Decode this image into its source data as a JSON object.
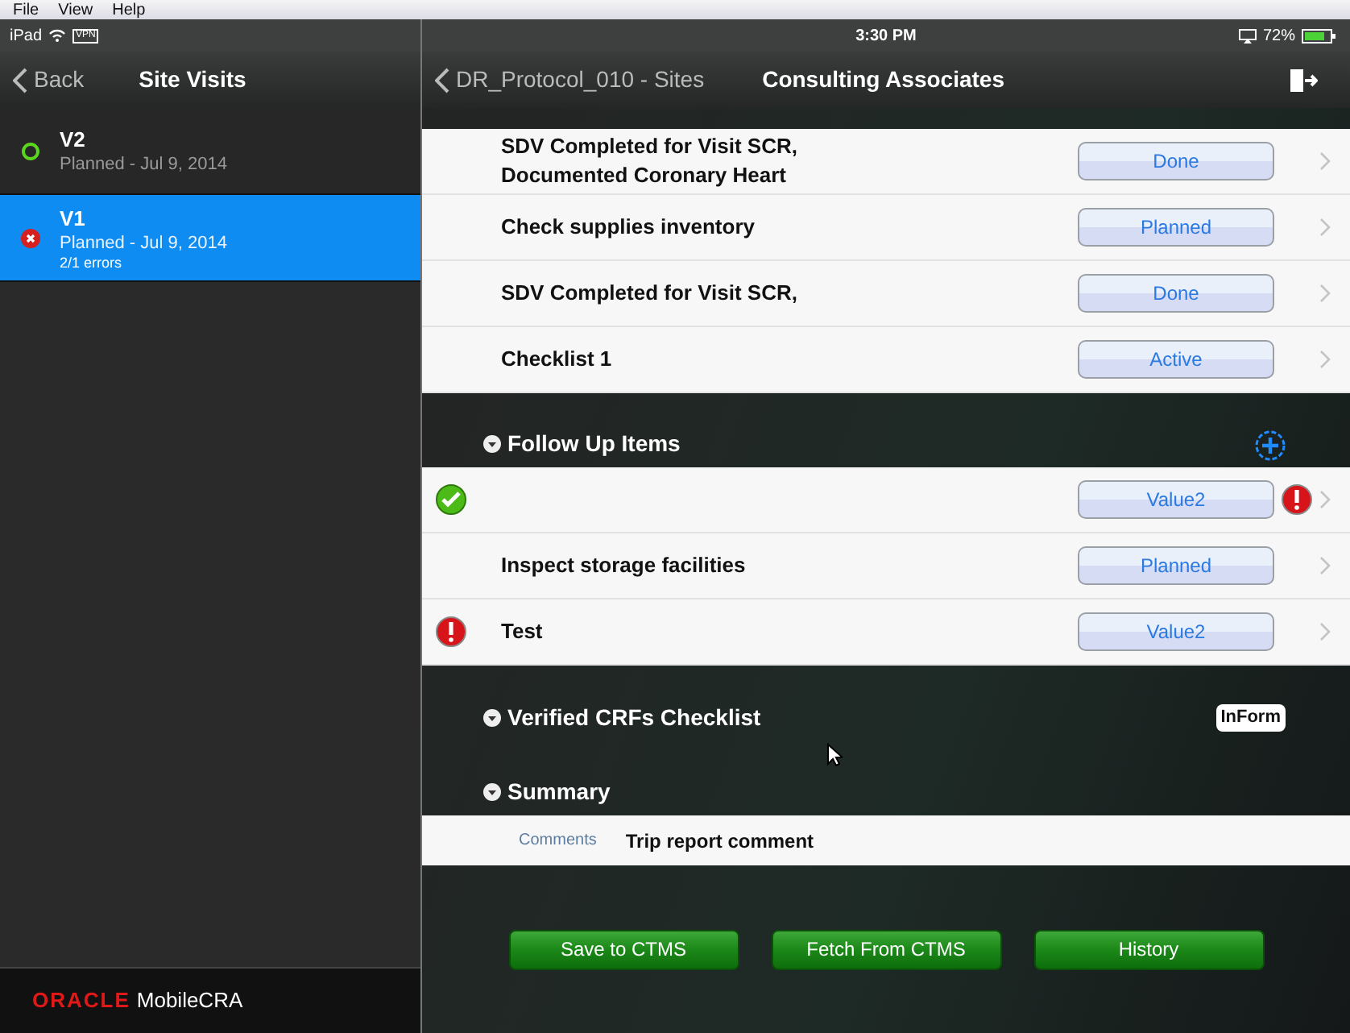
{
  "menu_bar": [
    "File",
    "View",
    "Help"
  ],
  "status_bar": {
    "device": "iPad",
    "vpn": "VPN",
    "time": "3:30 PM",
    "battery": "72%"
  },
  "left_nav": {
    "back": "Back",
    "title": "Site Visits"
  },
  "visits": [
    {
      "name": "V2",
      "detail": "Planned - Jul 9, 2014",
      "kind": "ok",
      "selected": false
    },
    {
      "name": "V1",
      "detail": "Planned - Jul 9, 2014",
      "errors": "2/1 errors",
      "kind": "error",
      "selected": true
    }
  ],
  "brand": {
    "logo": "ORACLE",
    "product": "MobileCRA"
  },
  "right_nav": {
    "back": "DR_Protocol_010 - Sites",
    "title": "Consulting Associates"
  },
  "checklist_items": [
    {
      "label": "SDV Completed for Visit SCR, Documented Coronary Heart",
      "status": "Done",
      "flag": false
    },
    {
      "label": "Check supplies inventory",
      "status": "Planned",
      "flag": false
    },
    {
      "label": "SDV Completed for Visit SCR,",
      "status": "Done",
      "flag": false
    },
    {
      "label": "Checklist 1",
      "status": "Active",
      "flag": false
    }
  ],
  "follow_up": {
    "title": "Follow Up Items",
    "items": [
      {
        "status": "Value2",
        "kind": "ok",
        "flag": true
      },
      {
        "label": "Inspect storage facilities",
        "status": "Planned",
        "flag": false
      },
      {
        "label": "Test",
        "status": "Value2",
        "kind": "error",
        "flag": false
      }
    ]
  },
  "verified": {
    "title": "Verified CRFs Checklist",
    "logo": "InForm"
  },
  "summary": {
    "title": "Summary",
    "field_label": "Comments",
    "value": "Trip report comment"
  },
  "actions": [
    "Save to CTMS",
    "Fetch From CTMS",
    "History"
  ]
}
